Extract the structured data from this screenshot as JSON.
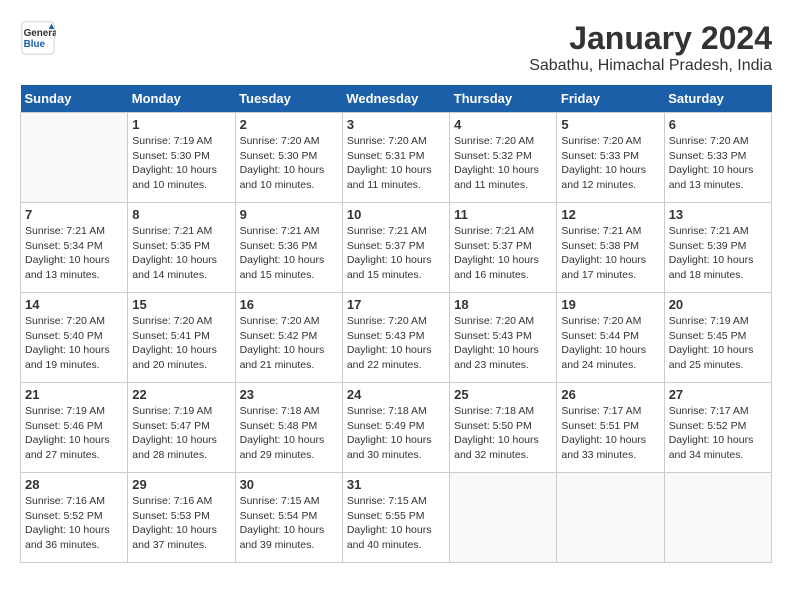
{
  "header": {
    "logo_line1": "General",
    "logo_line2": "Blue",
    "month_title": "January 2024",
    "location": "Sabathu, Himachal Pradesh, India"
  },
  "columns": [
    "Sunday",
    "Monday",
    "Tuesday",
    "Wednesday",
    "Thursday",
    "Friday",
    "Saturday"
  ],
  "weeks": [
    [
      {
        "day": "",
        "sunrise": "",
        "sunset": "",
        "daylight": ""
      },
      {
        "day": "1",
        "sunrise": "Sunrise: 7:19 AM",
        "sunset": "Sunset: 5:30 PM",
        "daylight": "Daylight: 10 hours and 10 minutes."
      },
      {
        "day": "2",
        "sunrise": "Sunrise: 7:20 AM",
        "sunset": "Sunset: 5:30 PM",
        "daylight": "Daylight: 10 hours and 10 minutes."
      },
      {
        "day": "3",
        "sunrise": "Sunrise: 7:20 AM",
        "sunset": "Sunset: 5:31 PM",
        "daylight": "Daylight: 10 hours and 11 minutes."
      },
      {
        "day": "4",
        "sunrise": "Sunrise: 7:20 AM",
        "sunset": "Sunset: 5:32 PM",
        "daylight": "Daylight: 10 hours and 11 minutes."
      },
      {
        "day": "5",
        "sunrise": "Sunrise: 7:20 AM",
        "sunset": "Sunset: 5:33 PM",
        "daylight": "Daylight: 10 hours and 12 minutes."
      },
      {
        "day": "6",
        "sunrise": "Sunrise: 7:20 AM",
        "sunset": "Sunset: 5:33 PM",
        "daylight": "Daylight: 10 hours and 13 minutes."
      }
    ],
    [
      {
        "day": "7",
        "sunrise": "Sunrise: 7:21 AM",
        "sunset": "Sunset: 5:34 PM",
        "daylight": "Daylight: 10 hours and 13 minutes."
      },
      {
        "day": "8",
        "sunrise": "Sunrise: 7:21 AM",
        "sunset": "Sunset: 5:35 PM",
        "daylight": "Daylight: 10 hours and 14 minutes."
      },
      {
        "day": "9",
        "sunrise": "Sunrise: 7:21 AM",
        "sunset": "Sunset: 5:36 PM",
        "daylight": "Daylight: 10 hours and 15 minutes."
      },
      {
        "day": "10",
        "sunrise": "Sunrise: 7:21 AM",
        "sunset": "Sunset: 5:37 PM",
        "daylight": "Daylight: 10 hours and 15 minutes."
      },
      {
        "day": "11",
        "sunrise": "Sunrise: 7:21 AM",
        "sunset": "Sunset: 5:37 PM",
        "daylight": "Daylight: 10 hours and 16 minutes."
      },
      {
        "day": "12",
        "sunrise": "Sunrise: 7:21 AM",
        "sunset": "Sunset: 5:38 PM",
        "daylight": "Daylight: 10 hours and 17 minutes."
      },
      {
        "day": "13",
        "sunrise": "Sunrise: 7:21 AM",
        "sunset": "Sunset: 5:39 PM",
        "daylight": "Daylight: 10 hours and 18 minutes."
      }
    ],
    [
      {
        "day": "14",
        "sunrise": "Sunrise: 7:20 AM",
        "sunset": "Sunset: 5:40 PM",
        "daylight": "Daylight: 10 hours and 19 minutes."
      },
      {
        "day": "15",
        "sunrise": "Sunrise: 7:20 AM",
        "sunset": "Sunset: 5:41 PM",
        "daylight": "Daylight: 10 hours and 20 minutes."
      },
      {
        "day": "16",
        "sunrise": "Sunrise: 7:20 AM",
        "sunset": "Sunset: 5:42 PM",
        "daylight": "Daylight: 10 hours and 21 minutes."
      },
      {
        "day": "17",
        "sunrise": "Sunrise: 7:20 AM",
        "sunset": "Sunset: 5:43 PM",
        "daylight": "Daylight: 10 hours and 22 minutes."
      },
      {
        "day": "18",
        "sunrise": "Sunrise: 7:20 AM",
        "sunset": "Sunset: 5:43 PM",
        "daylight": "Daylight: 10 hours and 23 minutes."
      },
      {
        "day": "19",
        "sunrise": "Sunrise: 7:20 AM",
        "sunset": "Sunset: 5:44 PM",
        "daylight": "Daylight: 10 hours and 24 minutes."
      },
      {
        "day": "20",
        "sunrise": "Sunrise: 7:19 AM",
        "sunset": "Sunset: 5:45 PM",
        "daylight": "Daylight: 10 hours and 25 minutes."
      }
    ],
    [
      {
        "day": "21",
        "sunrise": "Sunrise: 7:19 AM",
        "sunset": "Sunset: 5:46 PM",
        "daylight": "Daylight: 10 hours and 27 minutes."
      },
      {
        "day": "22",
        "sunrise": "Sunrise: 7:19 AM",
        "sunset": "Sunset: 5:47 PM",
        "daylight": "Daylight: 10 hours and 28 minutes."
      },
      {
        "day": "23",
        "sunrise": "Sunrise: 7:18 AM",
        "sunset": "Sunset: 5:48 PM",
        "daylight": "Daylight: 10 hours and 29 minutes."
      },
      {
        "day": "24",
        "sunrise": "Sunrise: 7:18 AM",
        "sunset": "Sunset: 5:49 PM",
        "daylight": "Daylight: 10 hours and 30 minutes."
      },
      {
        "day": "25",
        "sunrise": "Sunrise: 7:18 AM",
        "sunset": "Sunset: 5:50 PM",
        "daylight": "Daylight: 10 hours and 32 minutes."
      },
      {
        "day": "26",
        "sunrise": "Sunrise: 7:17 AM",
        "sunset": "Sunset: 5:51 PM",
        "daylight": "Daylight: 10 hours and 33 minutes."
      },
      {
        "day": "27",
        "sunrise": "Sunrise: 7:17 AM",
        "sunset": "Sunset: 5:52 PM",
        "daylight": "Daylight: 10 hours and 34 minutes."
      }
    ],
    [
      {
        "day": "28",
        "sunrise": "Sunrise: 7:16 AM",
        "sunset": "Sunset: 5:52 PM",
        "daylight": "Daylight: 10 hours and 36 minutes."
      },
      {
        "day": "29",
        "sunrise": "Sunrise: 7:16 AM",
        "sunset": "Sunset: 5:53 PM",
        "daylight": "Daylight: 10 hours and 37 minutes."
      },
      {
        "day": "30",
        "sunrise": "Sunrise: 7:15 AM",
        "sunset": "Sunset: 5:54 PM",
        "daylight": "Daylight: 10 hours and 39 minutes."
      },
      {
        "day": "31",
        "sunrise": "Sunrise: 7:15 AM",
        "sunset": "Sunset: 5:55 PM",
        "daylight": "Daylight: 10 hours and 40 minutes."
      },
      {
        "day": "",
        "sunrise": "",
        "sunset": "",
        "daylight": ""
      },
      {
        "day": "",
        "sunrise": "",
        "sunset": "",
        "daylight": ""
      },
      {
        "day": "",
        "sunrise": "",
        "sunset": "",
        "daylight": ""
      }
    ]
  ]
}
